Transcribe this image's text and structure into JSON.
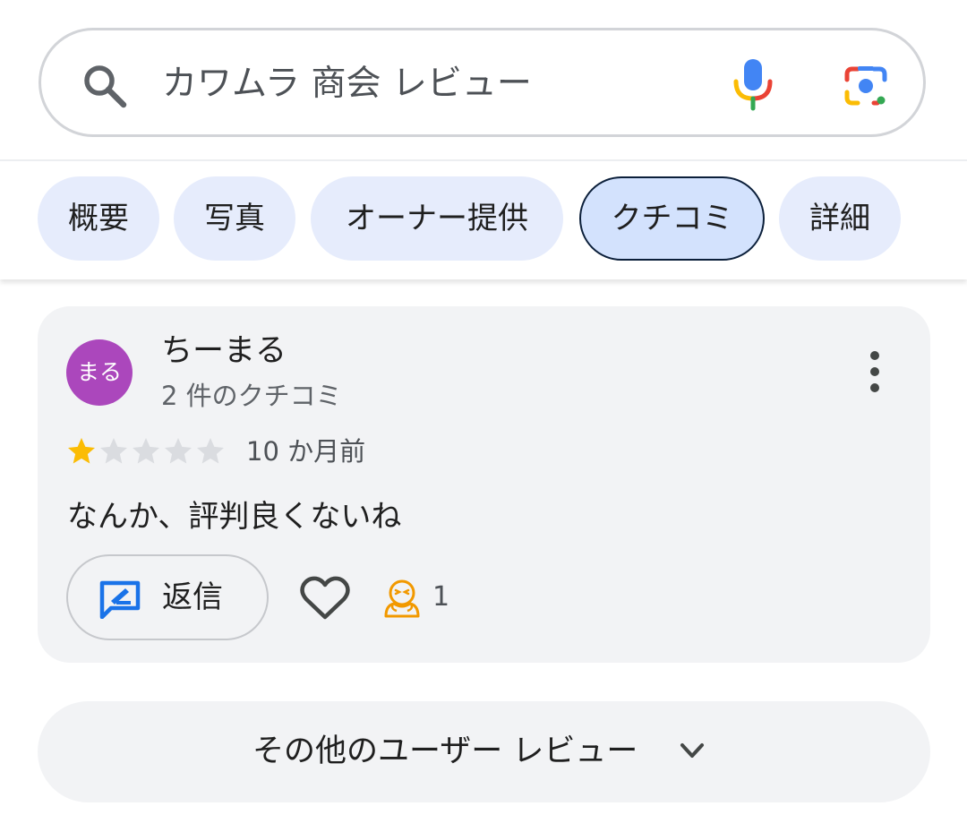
{
  "search": {
    "query": "カワムラ 商会 レビュー",
    "icons": [
      "search-icon",
      "mic-icon",
      "lens-icon"
    ]
  },
  "tabs": [
    {
      "label": "概要",
      "selected": false
    },
    {
      "label": "写真",
      "selected": false
    },
    {
      "label": "オーナー提供",
      "selected": false
    },
    {
      "label": "クチコミ",
      "selected": true
    },
    {
      "label": "詳細",
      "selected": false
    }
  ],
  "review": {
    "avatar_text": "まる",
    "avatar_color": "#ab47bc",
    "reviewer_name": "ちーまる",
    "review_count": "2 件のクチコミ",
    "rating": 1,
    "rating_max": 5,
    "date": "10 か月前",
    "text": "なんか、評判良くないね",
    "reply_label": "返信",
    "reaction_count": "1",
    "star_color": "#fbbc04"
  },
  "more_reviews": {
    "label": "その他のユーザー レビュー"
  },
  "colors": {
    "accent_blue": "#1a73e8",
    "chip_bg": "#e6ecfc",
    "chip_selected_bg": "#d3e2fd",
    "reaction_orange": "#f29900"
  }
}
